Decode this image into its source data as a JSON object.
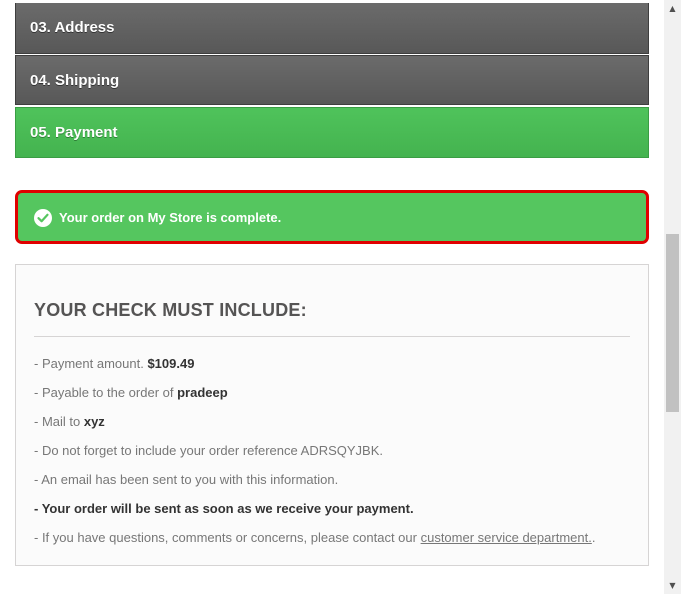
{
  "steps": [
    {
      "label": "03. Address",
      "state": "inactive"
    },
    {
      "label": "04. Shipping",
      "state": "inactive"
    },
    {
      "label": "05. Payment",
      "state": "active"
    }
  ],
  "alert": {
    "icon": "check-circle-icon",
    "message": "Your order on My Store is complete.",
    "highlight_color": "#e00000",
    "background_color": "#55c65f"
  },
  "check_box": {
    "title": "YOUR CHECK MUST INCLUDE:",
    "payment_amount_prefix": "- Payment amount. ",
    "payment_amount": "$109.49",
    "payable_prefix": "- Payable to the order of ",
    "payable_to": "pradeep",
    "mail_prefix": "- Mail to ",
    "mail_to": "xyz",
    "reference_text": "- Do not forget to include your order reference ADRSQYJBK.",
    "email_text": "- An email has been sent to you with this information.",
    "sent_prefix": "- ",
    "sent_text": "Your order will be sent as soon as we receive your payment.",
    "questions_prefix": "- If you have questions, comments or concerns, please contact our ",
    "questions_link": "customer service department.",
    "questions_suffix": "."
  },
  "scrollbar": {
    "up_icon": "scroll-up-arrow-icon",
    "down_icon": "scroll-down-arrow-icon"
  }
}
